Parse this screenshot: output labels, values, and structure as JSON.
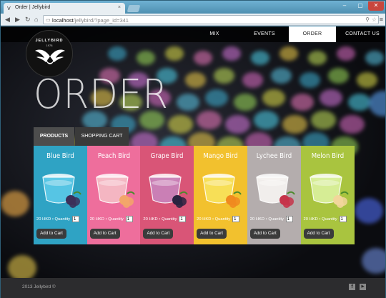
{
  "browser": {
    "tab_title": "Order | Jellybird",
    "url_host": "localhost",
    "url_path": "/jellybird/?page_id=341"
  },
  "nav": {
    "items": [
      "MIX",
      "EVENTS",
      "ORDER",
      "CONTACT US"
    ],
    "active": "ORDER"
  },
  "logo": {
    "title": "JELLYBIRD",
    "sub": "1978"
  },
  "page": {
    "title": "ORDER"
  },
  "tabs": {
    "products": "PRODUCTS",
    "cart": "SHOPPING CART"
  },
  "products": [
    {
      "name": "Blue Bird",
      "price": "20 HKD • Quantity",
      "qty": "1",
      "button": "Add to Cart",
      "color": "#2fa3c4",
      "jelly": "#59c7e6",
      "fruit": "#3c2f59"
    },
    {
      "name": "Peach Bird",
      "price": "20 HKD • Quantity",
      "qty": "1",
      "button": "Add to Cart",
      "color": "#ee6e9c",
      "jelly": "#f3b9c4",
      "fruit": "#f3a66a"
    },
    {
      "name": "Grape Bird",
      "price": "20 HKD • Quantity",
      "qty": "1",
      "button": "Add to Cart",
      "color": "#d95577",
      "jelly": "#c982b8",
      "fruit": "#2a2340"
    },
    {
      "name": "Mango Bird",
      "price": "20 HKD • Quantity",
      "qty": "1",
      "button": "Add to Cart",
      "color": "#f2c12e",
      "jelly": "#f7e05a",
      "fruit": "#f08a1f"
    },
    {
      "name": "Lychee Bird",
      "price": "20 HKD • Quantity",
      "qty": "1",
      "button": "Add to Cart",
      "color": "#b4adad",
      "jelly": "#f4f1ef",
      "fruit": "#c6344a"
    },
    {
      "name": "Melon Bird",
      "price": "20 HKD • Quantity",
      "qty": "1",
      "button": "Add to Cart",
      "color": "#a9c43f",
      "jelly": "#d8ef9a",
      "fruit": "#f2d69b"
    }
  ],
  "footer": {
    "copyright": "2013 Jellybird ©",
    "social": [
      "facebook-icon",
      "youtube-icon"
    ]
  }
}
